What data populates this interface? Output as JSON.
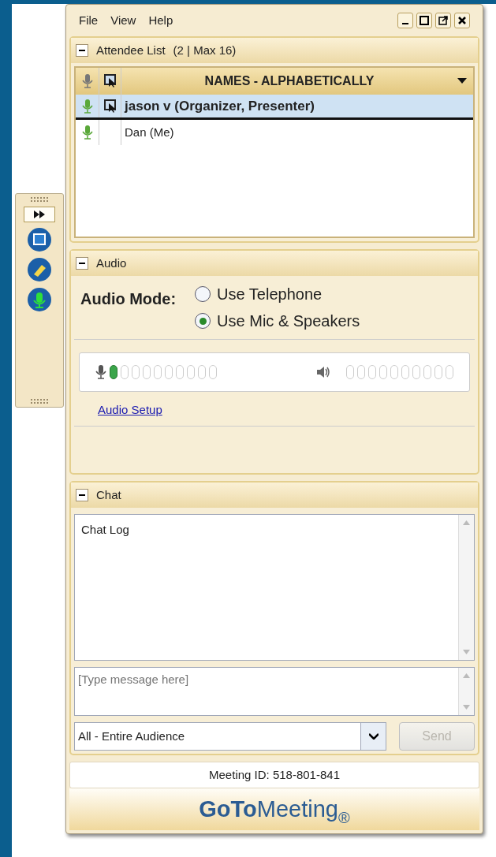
{
  "menu": [
    "File",
    "View",
    "Help"
  ],
  "attendee_panel": {
    "title": "Attendee List",
    "count": "(2 | Max 16)",
    "column_header": "NAMES - ALPHABETICALLY",
    "attendees": [
      {
        "name": "jason v (Organizer, Presenter)",
        "selected": true,
        "presenter": true
      },
      {
        "name": "Dan (Me)",
        "selected": false,
        "presenter": false
      }
    ]
  },
  "audio_panel": {
    "title": "Audio",
    "mode_label": "Audio Mode:",
    "modes": [
      {
        "label": "Use Telephone",
        "selected": false
      },
      {
        "label": "Use Mic & Speakers",
        "selected": true
      }
    ],
    "mic_meter": {
      "level": 0.1
    },
    "setup_link": "Audio Setup"
  },
  "chat_panel": {
    "title": "Chat",
    "log": "Chat Log",
    "message_placeholder": "[Type message here]",
    "recipient": "All - Entire Audience",
    "send": {
      "label": "Send",
      "disabled": true
    }
  },
  "meeting_id": "Meeting ID: 518-801-841",
  "logo": {
    "bold": "GoTo",
    "light": "Meeting",
    "mark": "®"
  }
}
